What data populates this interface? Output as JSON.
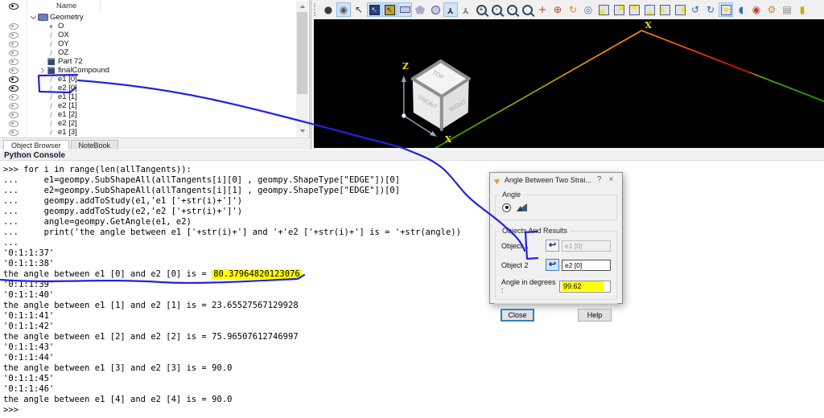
{
  "object_browser": {
    "header": {
      "name_column": "Name"
    },
    "tabs": [
      {
        "label": "Object Browser",
        "active": true
      },
      {
        "label": "NoteBook",
        "active": false
      }
    ],
    "tree": [
      {
        "label": "Geometry",
        "icon": "module",
        "expander": "open",
        "eye": "none",
        "indent": 1
      },
      {
        "label": "O",
        "icon": "plus",
        "expander": null,
        "eye": "grey",
        "indent": 2
      },
      {
        "label": "OX",
        "icon": "line",
        "expander": null,
        "eye": "grey",
        "indent": 2
      },
      {
        "label": "OY",
        "icon": "line",
        "expander": null,
        "eye": "grey",
        "indent": 2
      },
      {
        "label": "OZ",
        "icon": "line",
        "expander": null,
        "eye": "grey",
        "indent": 2
      },
      {
        "label": "Part 72",
        "icon": "box",
        "expander": null,
        "eye": "grey",
        "indent": 2
      },
      {
        "label": "finalCompound",
        "icon": "box",
        "expander": "closed",
        "eye": "grey",
        "indent": 2
      },
      {
        "label": "e1 [0]",
        "icon": "line",
        "expander": null,
        "eye": "dark",
        "indent": 2
      },
      {
        "label": "e2 [0]",
        "icon": "line",
        "expander": null,
        "eye": "dark",
        "indent": 2
      },
      {
        "label": "e1 [1]",
        "icon": "line",
        "expander": null,
        "eye": "grey",
        "indent": 2
      },
      {
        "label": "e2 [1]",
        "icon": "line",
        "expander": null,
        "eye": "grey",
        "indent": 2
      },
      {
        "label": "e1 [2]",
        "icon": "line",
        "expander": null,
        "eye": "grey",
        "indent": 2
      },
      {
        "label": "e2 [2]",
        "icon": "line",
        "expander": null,
        "eye": "grey",
        "indent": 2
      },
      {
        "label": "e1 [3]",
        "icon": "line",
        "expander": null,
        "eye": "grey",
        "indent": 2
      }
    ]
  },
  "viewport": {
    "toolbar": [
      {
        "name": "interaction-style-icon",
        "type": "glyph",
        "glyph": "●",
        "color": "#3a3a3a",
        "active": false
      },
      {
        "name": "viewcube-style-icon",
        "type": "glyph",
        "glyph": "◉",
        "color": "#5a5a5a",
        "active": true
      },
      {
        "name": "selection-cursor-icon",
        "type": "glyph",
        "glyph": "↖",
        "color": "#333333",
        "active": false
      },
      {
        "name": "highlight-select-icon",
        "type": "boxcursor",
        "bg": "#24418c",
        "fg": "#ffd24a",
        "active": true
      },
      {
        "name": "preselect-icon",
        "type": "boxcursor",
        "bg": "#b7a437",
        "fg": "#222222",
        "active": true
      },
      {
        "name": "rect-selection-icon",
        "type": "shape-rect",
        "active": true
      },
      {
        "name": "polygon-selection-icon",
        "type": "shape-pentagon",
        "active": false
      },
      {
        "name": "circle-selection-icon",
        "type": "shape-circle",
        "active": false
      },
      {
        "name": "trihedron-icon",
        "type": "glyph-rot",
        "glyph": "Y",
        "color": "#333333",
        "active": true
      },
      {
        "name": "view-trihedron-icon",
        "type": "glyph-rot",
        "glyph": "Y",
        "color": "#7a7a7a",
        "active": false
      },
      {
        "name": "zoom-in-icon",
        "type": "magnifier",
        "inner": "+",
        "active": false
      },
      {
        "name": "zoom-window-icon",
        "type": "magnifier",
        "inner": "▫",
        "active": false
      },
      {
        "name": "zoom-selection-icon",
        "type": "magnifier",
        "inner": "·",
        "active": false
      },
      {
        "name": "magnifier-icon",
        "type": "magnifier",
        "inner": "",
        "active": false
      },
      {
        "name": "pan-icon",
        "type": "glyph",
        "glyph": "+",
        "color": "#b23b2e",
        "active": false
      },
      {
        "name": "rotation-point-icon",
        "type": "glyph",
        "glyph": "⊕",
        "color": "#b23b2e",
        "active": false
      },
      {
        "name": "rotate-view-icon",
        "type": "glyph",
        "glyph": "↻",
        "color": "#c89020",
        "active": false
      },
      {
        "name": "global-pan-icon",
        "type": "glyph",
        "glyph": "◎",
        "color": "#3a6fb0",
        "active": false
      },
      {
        "name": "front-view-icon",
        "type": "cube",
        "face": "front",
        "active": false
      },
      {
        "name": "back-view-icon",
        "type": "cube",
        "face": "back",
        "active": false
      },
      {
        "name": "top-view-icon",
        "type": "cube",
        "face": "top",
        "active": false
      },
      {
        "name": "bottom-view-icon",
        "type": "cube",
        "face": "bottom",
        "active": false
      },
      {
        "name": "left-view-icon",
        "type": "cube",
        "face": "left",
        "active": false
      },
      {
        "name": "right-view-icon",
        "type": "cube",
        "face": "right",
        "active": false
      },
      {
        "name": "rotate-ccw-icon",
        "type": "glyph",
        "glyph": "↺",
        "color": "#2c62b8",
        "active": false
      },
      {
        "name": "rotate-cw-icon",
        "type": "glyph",
        "glyph": "↻",
        "color": "#2c62b8",
        "active": false
      },
      {
        "name": "iso-view-icon",
        "type": "cube",
        "face": "iso",
        "active": true
      },
      {
        "name": "clipping-icon",
        "type": "glyph",
        "glyph": "◖",
        "color": "#3a6fb0",
        "active": false
      },
      {
        "name": "shading-color-icon",
        "type": "glyph",
        "glyph": "◉",
        "color": "#c0392b",
        "active": false
      },
      {
        "name": "sweep-icon",
        "type": "glyph",
        "glyph": "⚙",
        "color": "#c89020",
        "active": false
      },
      {
        "name": "camera-icon",
        "type": "glyph",
        "glyph": "▤",
        "color": "#808080",
        "active": false
      },
      {
        "name": "scale-icon",
        "type": "glyph",
        "glyph": "▮",
        "color": "#c8b000",
        "active": false
      }
    ],
    "cube_labels": {
      "top": "TOP",
      "front": "FRONT",
      "right": "RIGHT"
    },
    "axis_labels": {
      "z": "Z",
      "x": "X"
    },
    "vertex_label": "X",
    "line_colors": {
      "green": "#2aa400",
      "orange": "#ff9400",
      "red": "#ee1100"
    }
  },
  "console": {
    "title": "Python Console",
    "lines": [
      ">>> for i in range(len(allTangents)):",
      "...     e1=geompy.SubShapeAll(allTangents[i][0] , geompy.ShapeType[\"EDGE\"])[0]",
      "...     e2=geompy.SubShapeAll(allTangents[i][1] , geompy.ShapeType[\"EDGE\"])[0]",
      "...     geompy.addToStudy(e1,'e1 ['+str(i)+']')",
      "...     geompy.addToStudy(e2,'e2 ['+str(i)+']')",
      "...     angle=geompy.GetAngle(e1, e2)",
      "...     print('the angle between e1 ['+str(i)+'] and '+'e2 ['+str(i)+'] is = '+str(angle))",
      "...",
      "'0:1:1:37'",
      "'0:1:1:38'",
      {
        "pre": "the angle between e1 [0] and e2 [0] is = ",
        "hl": "80.37964820123076"
      },
      "'0:1:1:39'",
      "'0:1:1:40'",
      "the angle between e1 [1] and e2 [1] is = 23.65527567129928",
      "'0:1:1:41'",
      "'0:1:1:42'",
      "the angle between e1 [2] and e2 [2] is = 75.96507612746997",
      "'0:1:1:43'",
      "'0:1:1:44'",
      "the angle between e1 [3] and e2 [3] is = 90.0",
      "'0:1:1:45'",
      "'0:1:1:46'",
      "the angle between e1 [4] and e2 [4] is = 90.0",
      ">>>"
    ]
  },
  "dialog": {
    "title": "Angle Between Two Strai...",
    "help_glyph": "?",
    "close_glyph": "×",
    "angle_group": "Angle",
    "objects_group": "Objects And Results",
    "object1_label": "Object 1",
    "object1_value": "e1 [0]",
    "object2_label": "Object 2",
    "object2_value": "e2 [0]",
    "angle_label": "Angle in degrees :",
    "angle_value": "99.62",
    "close_button": "Close",
    "help_button": "Help"
  },
  "colors": {
    "annotation_blue": "#2222dd",
    "annotation_yellow": "#ffff00",
    "axis_label_yellow": "#f0e000",
    "viewport_bg": "#000000"
  }
}
